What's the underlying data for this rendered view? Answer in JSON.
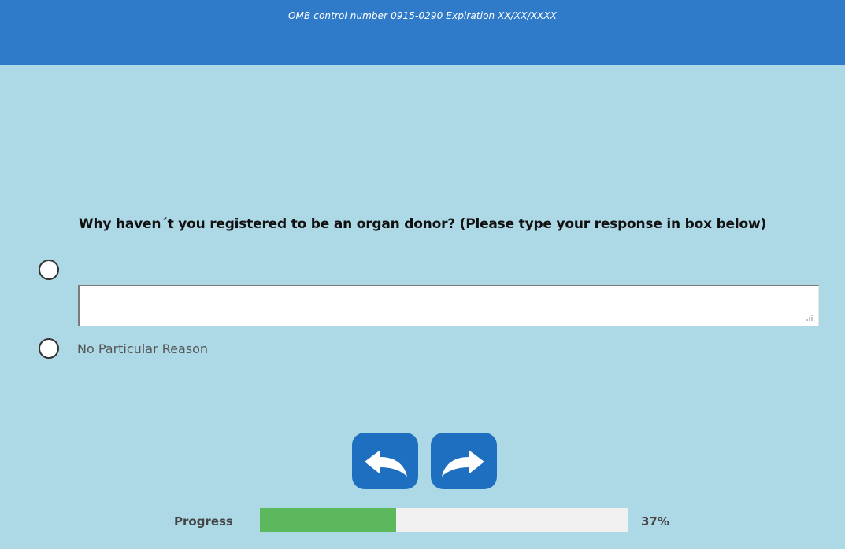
{
  "header": {
    "omb_text": "OMB control number 0915-0290 Expiration XX/XX/XXXX",
    "color": "#2f7bca"
  },
  "page": {
    "background": "#add8e6"
  },
  "question": {
    "text": "Why haven´t you registered to be an organ donor? (Please type your response in box below)",
    "options": [
      {
        "type": "radio-with-text",
        "selected": false,
        "text_value": ""
      },
      {
        "type": "radio",
        "label": "No Particular Reason",
        "selected": false
      }
    ]
  },
  "navigation": {
    "back_icon": "back-arrow-icon",
    "next_icon": "forward-arrow-icon",
    "button_color": "#1e6fc0"
  },
  "progress": {
    "label": "Progress",
    "percent": 37,
    "display": "37%",
    "fill_color": "#5cb85c"
  }
}
